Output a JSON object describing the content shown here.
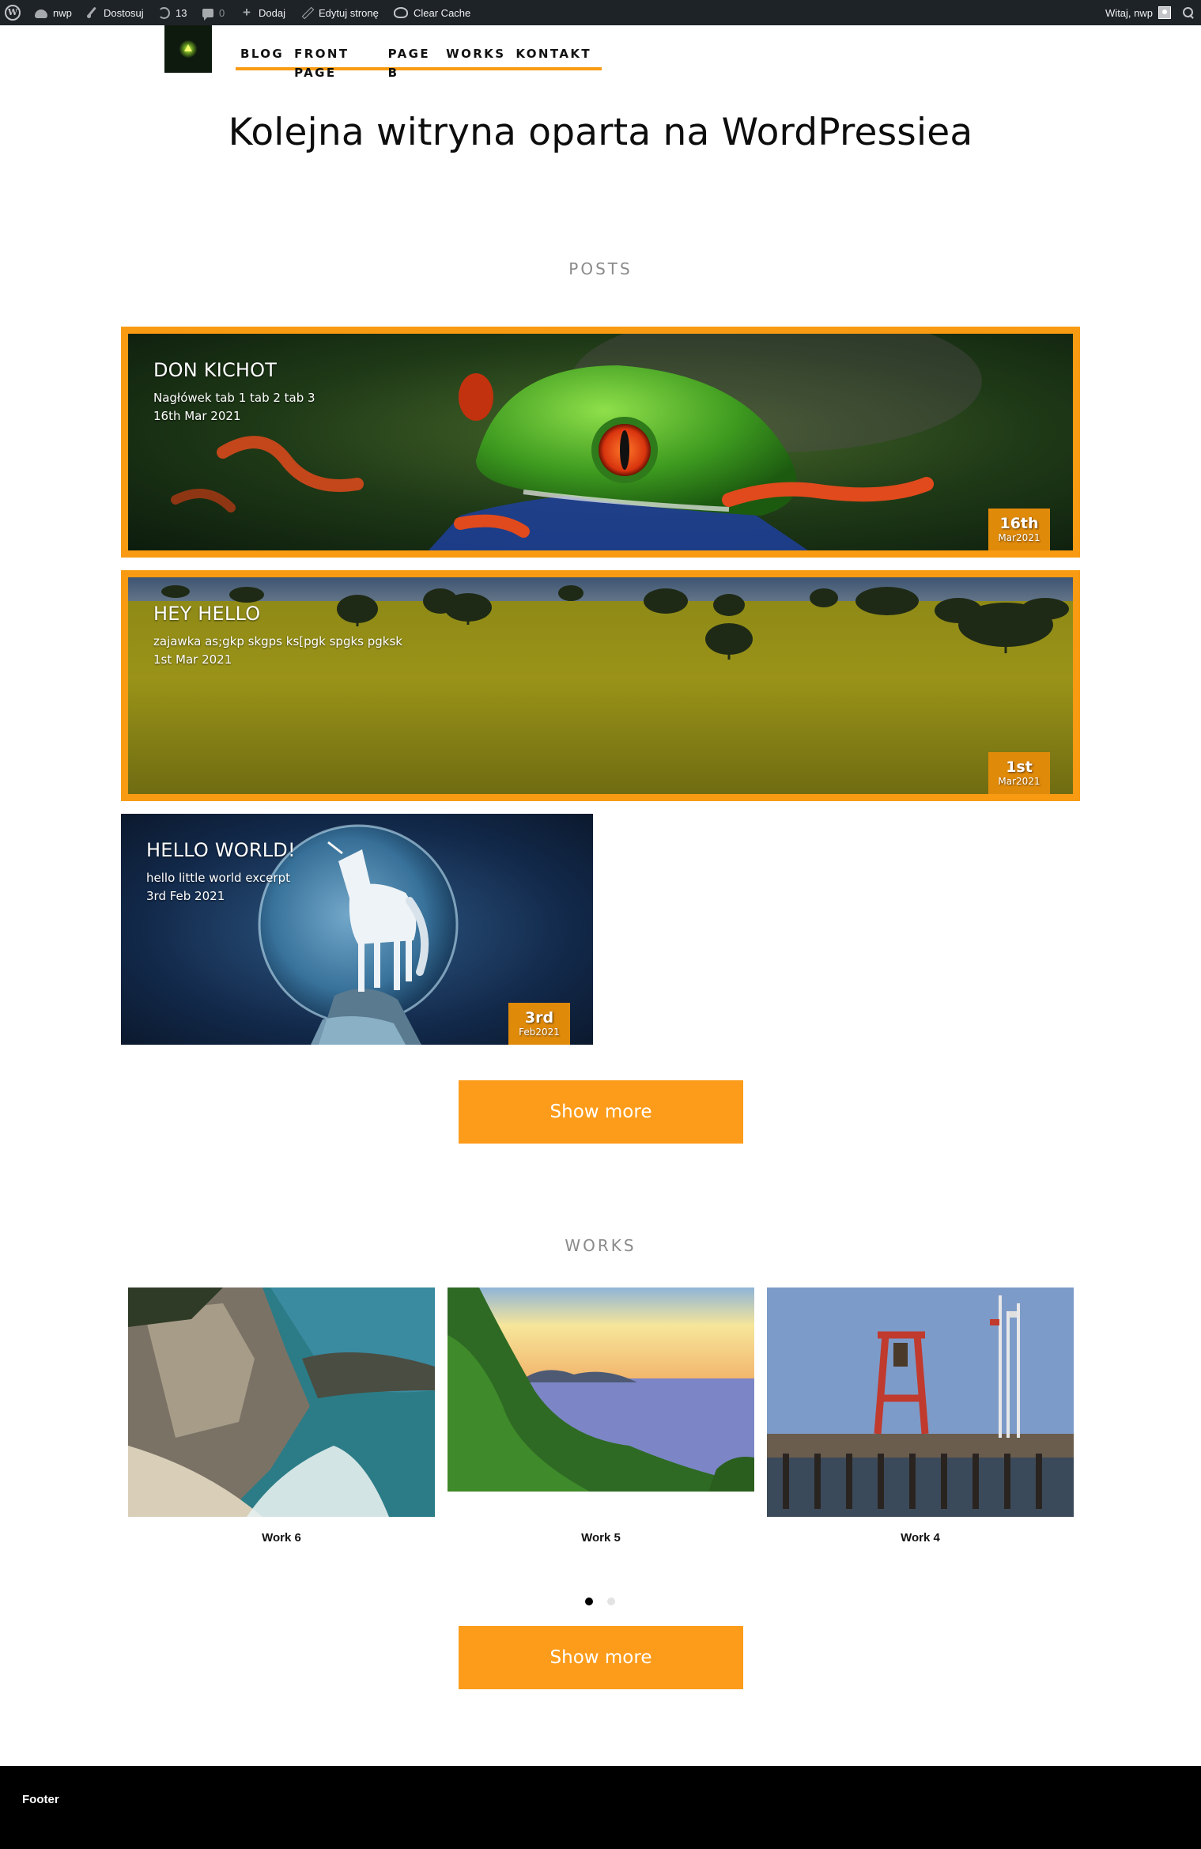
{
  "admin_bar": {
    "site_name": "nwp",
    "customize": "Dostosuj",
    "updates_count": "13",
    "comments_count": "0",
    "new_label": "Dodaj",
    "edit_page": "Edytuj stronę",
    "clear_cache": "Clear Cache",
    "greeting": "Witaj, nwp"
  },
  "nav": {
    "items": [
      "BLOG",
      "FRONT PAGE",
      "PAGE B",
      "WORKS",
      "KONTAKT"
    ]
  },
  "site_title": "Kolejna witryna oparta na WordPressiea",
  "posts_section": {
    "title": "POSTS",
    "posts": [
      {
        "title": "DON KICHOT",
        "excerpt": "Nagłówek tab 1 tab 2 tab 3",
        "date": "16th Mar 2021",
        "day": "16th",
        "month_year": "Mar2021",
        "image": "frog-image"
      },
      {
        "title": "HEY HELLO",
        "excerpt": "zajawka as;gkp skgps ks[pgk spgks pgksk",
        "date": "1st Mar 2021",
        "day": "1st",
        "month_year": "Mar2021",
        "image": "field-image"
      },
      {
        "title": "HELLO WORLD!",
        "excerpt": "hello little world excerpt",
        "date": "3rd Feb 2021",
        "day": "3rd",
        "month_year": "Feb2021",
        "image": "unicorn-image"
      }
    ],
    "show_more": "Show more"
  },
  "works_section": {
    "title": "WORKS",
    "works": [
      {
        "label": "Work 6",
        "image": "coast-cove-image"
      },
      {
        "label": "Work 5",
        "image": "sunset-bay-image"
      },
      {
        "label": "Work 4",
        "image": "pier-bell-image"
      }
    ],
    "show_more": "Show more"
  },
  "footer": {
    "text": "Footer"
  },
  "colors": {
    "accent": "#f89b12",
    "button": "#fd9c1a",
    "admin_bar": "#1d2327",
    "footer": "#000000"
  }
}
